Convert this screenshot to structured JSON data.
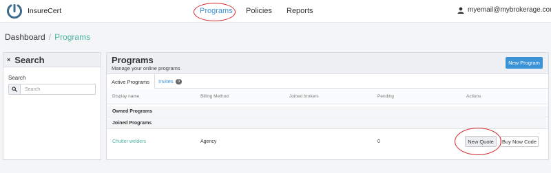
{
  "brand": {
    "name": "InsureCert",
    "logo_icon": "insurecert-logo-icon"
  },
  "nav": {
    "items": [
      {
        "label": "Programs",
        "active": true
      },
      {
        "label": "Policies",
        "active": false
      },
      {
        "label": "Reports",
        "active": false
      }
    ]
  },
  "user": {
    "email": "myemail@mybrokerage.com",
    "icon": "user-icon",
    "caret": "▾"
  },
  "breadcrumb": {
    "root": "Dashboard",
    "separator": "/",
    "current": "Programs"
  },
  "search_panel": {
    "close_glyph": "×",
    "title": "Search",
    "field_label": "Search",
    "placeholder": "Search",
    "icon": "search-icon"
  },
  "programs": {
    "title": "Programs",
    "subtitle": "Manage your online programs",
    "new_program_label": "New Program",
    "tabs": {
      "active": "Active Programs",
      "invites": "Invites",
      "invites_count": "0"
    },
    "columns": [
      "Display name",
      "Billing Method",
      "Joined brokers",
      "Pending",
      "Actions"
    ],
    "groups": {
      "owned": "Owned Programs",
      "joined": "Joined Programs"
    },
    "rows": [
      {
        "name": "Chutter welders",
        "billing": "Agency",
        "joined": "",
        "pending": "0",
        "actions": {
          "new_quote": "New Quote",
          "buy_now": "Buy Now Code"
        }
      }
    ]
  },
  "colors": {
    "accent": "#3a93d6",
    "link": "#4fb3a4",
    "annotation": "#d9262a"
  }
}
